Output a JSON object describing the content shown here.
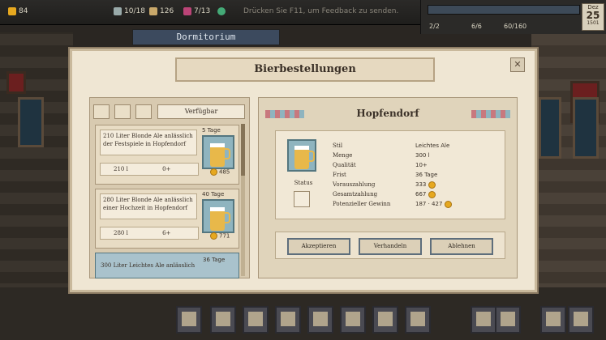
{
  "topbar": {
    "stat_1": "84",
    "stat_2": "10/18",
    "stat_3": "126",
    "stat_4": "7/13",
    "feedback": "Drücken Sie F11, um Feedback zu senden.",
    "staff_1": "2/2",
    "staff_2": "6/6",
    "storage": "60/160",
    "calendar": {
      "month": "Dez",
      "day": "25",
      "year": "1501"
    }
  },
  "location": {
    "name": "Dormitorium"
  },
  "dialog": {
    "title": "Bierbestellungen",
    "filter_label": "Verfügbar",
    "orders": [
      {
        "desc": "210 Liter Blonde Ale anlässlich der Festspiele in Hopfendorf",
        "days": "5 Tage",
        "amount": "210 l",
        "quality": "0+",
        "payment": "485"
      },
      {
        "desc": "280 Liter Blonde Ale anlässlich einer Hochzeit in Hopfendorf",
        "days": "40 Tage",
        "amount": "280 l",
        "quality": "6+",
        "payment": "771"
      },
      {
        "desc": "300 Liter Leichtes Ale anlässlich",
        "days": "36 Tage"
      }
    ],
    "detail": {
      "title": "Hopfendorf",
      "status_label": "Status",
      "rows": [
        {
          "key": "Stil",
          "value": "Leichtes Ale"
        },
        {
          "key": "Menge",
          "value": "300 l"
        },
        {
          "key": "Qualität",
          "value": "10+"
        },
        {
          "key": "Frist",
          "value": "36 Tage"
        },
        {
          "key": "Vorauszahlung",
          "value": "333"
        },
        {
          "key": "Gesamtzahlung",
          "value": "667"
        },
        {
          "key": "Potenzieller Gewinn",
          "value": "187 · 427"
        }
      ],
      "buttons": {
        "accept": "Akzeptieren",
        "negotiate": "Verhandeln",
        "decline": "Ablehnen"
      }
    }
  },
  "colors": {
    "panel": "#efe6d3",
    "accent": "#5e6e7c",
    "coin": "#e6a81f",
    "beer": "#e8b84a"
  }
}
